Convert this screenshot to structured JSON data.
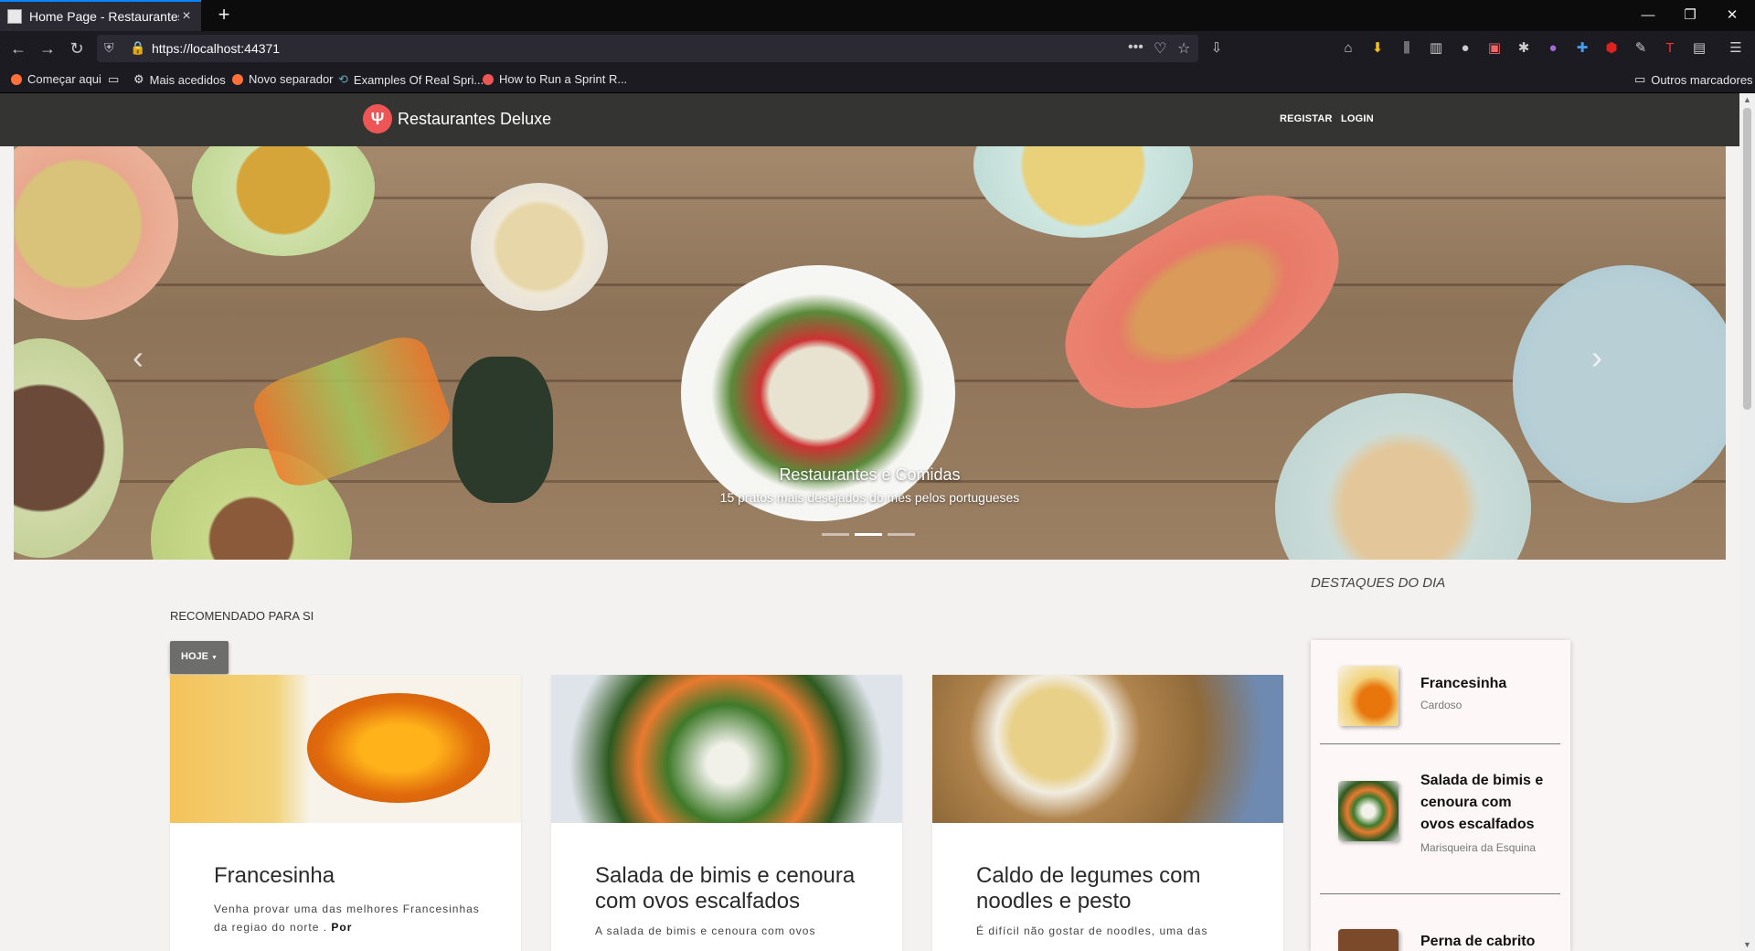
{
  "browser": {
    "tab_title": "Home Page - Restaurantes Del",
    "url": "https://localhost:44371",
    "bookmarks": [
      "Começar aqui",
      "Mais acedidos",
      "Novo separador",
      "Examples Of Real Spri...",
      "How to Run a Sprint R..."
    ],
    "other_bookmarks": "Outros marcadores"
  },
  "site": {
    "brand": "Restaurantes Deluxe",
    "nav": {
      "register": "REGISTAR",
      "login": "LOGIN"
    }
  },
  "hero": {
    "title": "Restaurantes e Comidas",
    "subtitle": "15 pratos mais desejados do mês pelos portugueses",
    "active_slide": 2,
    "slide_count": 3
  },
  "recommended": {
    "title": "RECOMENDADO PARA SI",
    "filter": "HOJE"
  },
  "cards": [
    {
      "title": "Francesinha",
      "desc": "Venha provar uma das melhores Francesinhas da regiao do norte .",
      "desc_bold": "Por"
    },
    {
      "title": "Salada de bimis e cenoura com ovos escalfados",
      "desc": "A salada de bimis e cenoura com ovos",
      "desc_bold": ""
    },
    {
      "title": "Caldo de legumes com noodles e pesto",
      "desc": "É difícil não gostar de noodles, uma das",
      "desc_bold": ""
    }
  ],
  "highlights": {
    "title": "DESTAQUES DO DIA",
    "items": [
      {
        "name": "Francesinha",
        "place": "Cardoso"
      },
      {
        "name": "Salada de bimis e cenoura com ovos escalfados",
        "place": "Marisqueira da Esquina"
      },
      {
        "name": "Perna de cabrito",
        "place": ""
      }
    ]
  },
  "colors": {
    "navbar": "#343432",
    "accent": "#0a84ff",
    "card_bg": "#ffffff",
    "sidebar_bg": "#fdf7f7"
  }
}
